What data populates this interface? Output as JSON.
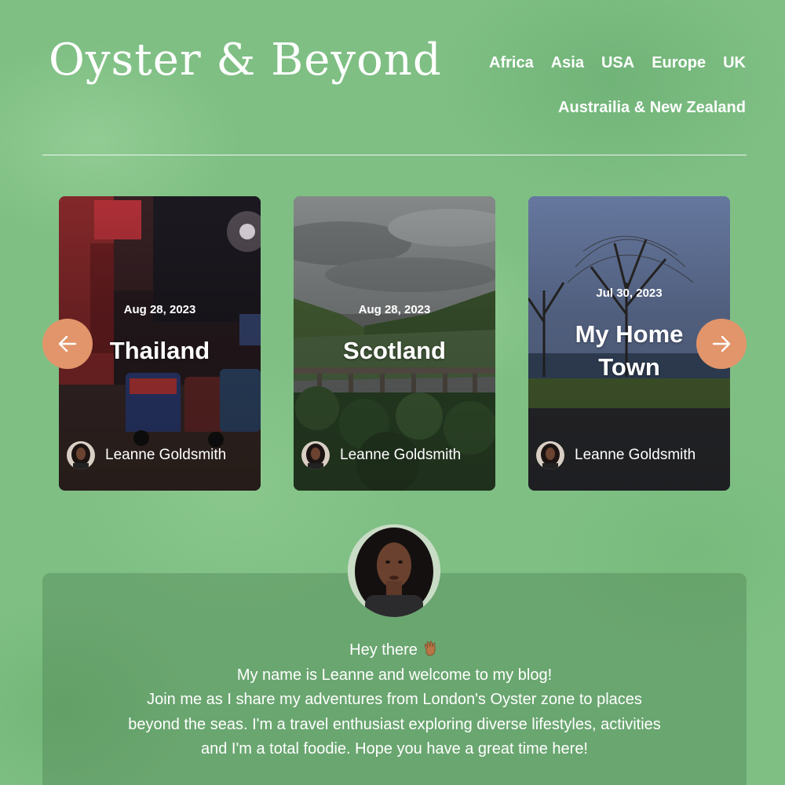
{
  "header": {
    "title": "Oyster & Beyond",
    "nav_row1": [
      "Africa",
      "Asia",
      "USA",
      "Europe",
      "UK"
    ],
    "nav_row2": [
      "Austrailia & New Zealand"
    ]
  },
  "carousel": {
    "cards": [
      {
        "date": "Aug 28, 2023",
        "title": "Thailand",
        "author": "Leanne Goldsmith"
      },
      {
        "date": "Aug 28, 2023",
        "title": "Scotland",
        "author": "Leanne Goldsmith"
      },
      {
        "date": "Jul 30, 2023",
        "title": "My Home Town",
        "author": "Leanne Goldsmith"
      }
    ],
    "prev_icon": "arrow-left-icon",
    "next_icon": "arrow-right-icon",
    "accent_color": "#e2956a"
  },
  "about": {
    "greeting": "Hey there",
    "greeting_icon": "waving-hand-icon",
    "lines": [
      "My name is Leanne and welcome to my blog!",
      "Join me as I share my adventures from London's Oyster zone to places",
      "beyond the seas. I'm a travel enthusiast exploring diverse lifestyles, activities",
      "and I'm a total foodie. Hope you have a great time here!"
    ]
  }
}
